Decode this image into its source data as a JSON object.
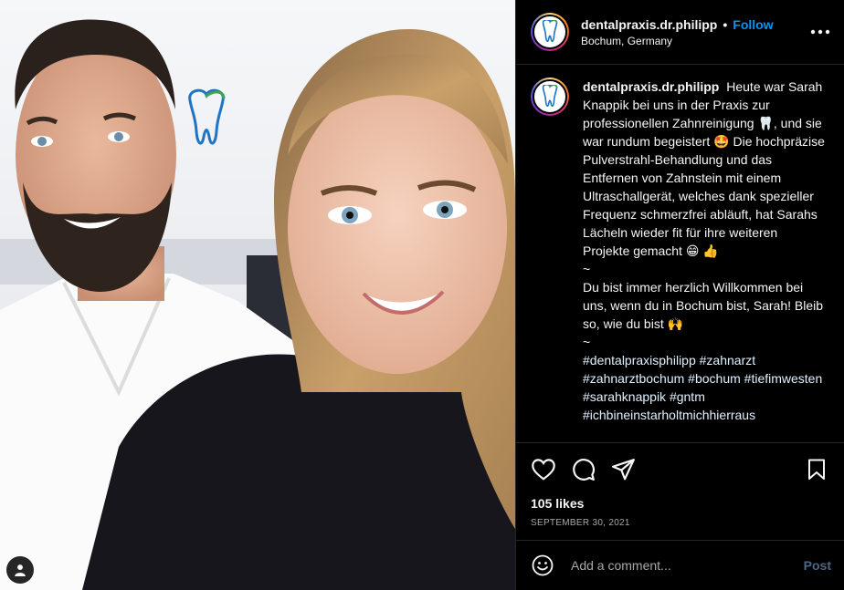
{
  "post": {
    "username": "dentalpraxis.dr.philipp",
    "dot": "•",
    "follow_label": "Follow",
    "location": "Bochum, Germany",
    "caption": "Heute war Sarah Knappik bei uns in der Praxis zur professionellen Zahnreinigung 🦷, und sie war rundum begeistert 🤩 Die hochpräzise Pulverstrahl-Behandlung und das Entfernen von Zahnstein mit einem Ultraschallgerät, welches dank spezieller Frequenz schmerzfrei abläuft, hat Sarahs Lächeln wieder fit für ihre weiteren Projekte gemacht 😁 👍\n~\nDu bist immer herzlich Willkommen bei uns, wenn du in Bochum bist, Sarah! Bleib so, wie du bist 🙌\n~",
    "hashtags": "#dentalpraxisphilipp #zahnarzt #zahnarztbochum #bochum #tiefimwesten #sarahknappik #gntm #ichbineinstarholtmichhierraus",
    "likes": "105 likes",
    "date": "SEPTEMBER 30, 2021"
  },
  "icons": {
    "like": "heart-icon",
    "comment": "comment-icon",
    "share": "paper-plane-icon",
    "save": "bookmark-icon",
    "more": "more-horizontal-icon",
    "emoji": "emoji-icon",
    "tagged": "user-tag-icon"
  },
  "comment_box": {
    "placeholder": "Add a comment...",
    "post_label": "Post"
  },
  "colors": {
    "accent": "#0095f6",
    "background": "#000000",
    "post_disabled": "#4a6787"
  }
}
